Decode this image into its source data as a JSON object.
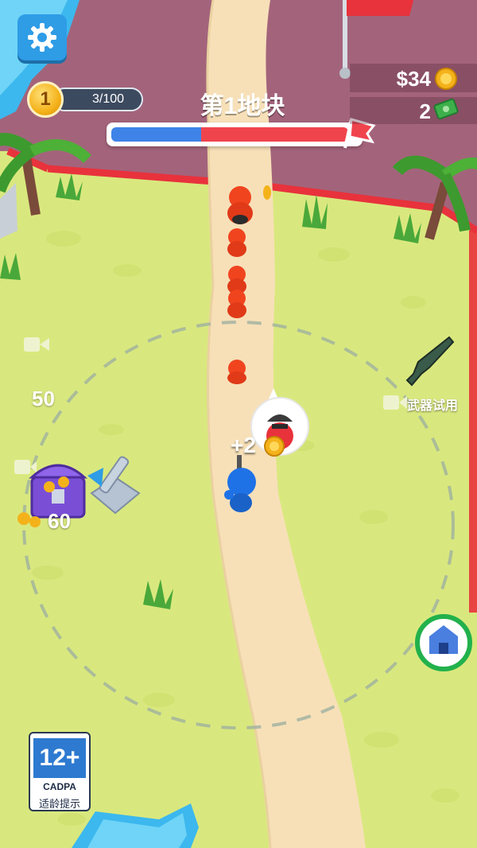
{
  "hud": {
    "level": "1",
    "level_progress": "3/100",
    "stage_title": "第1地块",
    "stage_progress_fraction": 0.38,
    "money": "$34",
    "cash": "2"
  },
  "world": {
    "zone_cost_left": "50",
    "chest_cost": "60",
    "coin_popup": "+2",
    "weapon_trial_label": "武器试用"
  },
  "age_rating": {
    "rating": "12+",
    "org": "CADPA",
    "tip": "适龄提示"
  },
  "colors": {
    "grass": "#d9e87e",
    "path": "#f7e0b8",
    "enemy_zone": "#a3647b",
    "enemy_border": "#e8323c",
    "player": "#1f72e6",
    "enemy": "#f0441f",
    "settings_button": "#2f9ce6"
  },
  "icons": [
    "gear-icon",
    "coin-icon",
    "cash-icon",
    "flag-icon",
    "video-ad-icon",
    "shotgun-icon",
    "treasure-chest-icon",
    "turret-icon",
    "base-icon",
    "enemy-skull-icon"
  ]
}
